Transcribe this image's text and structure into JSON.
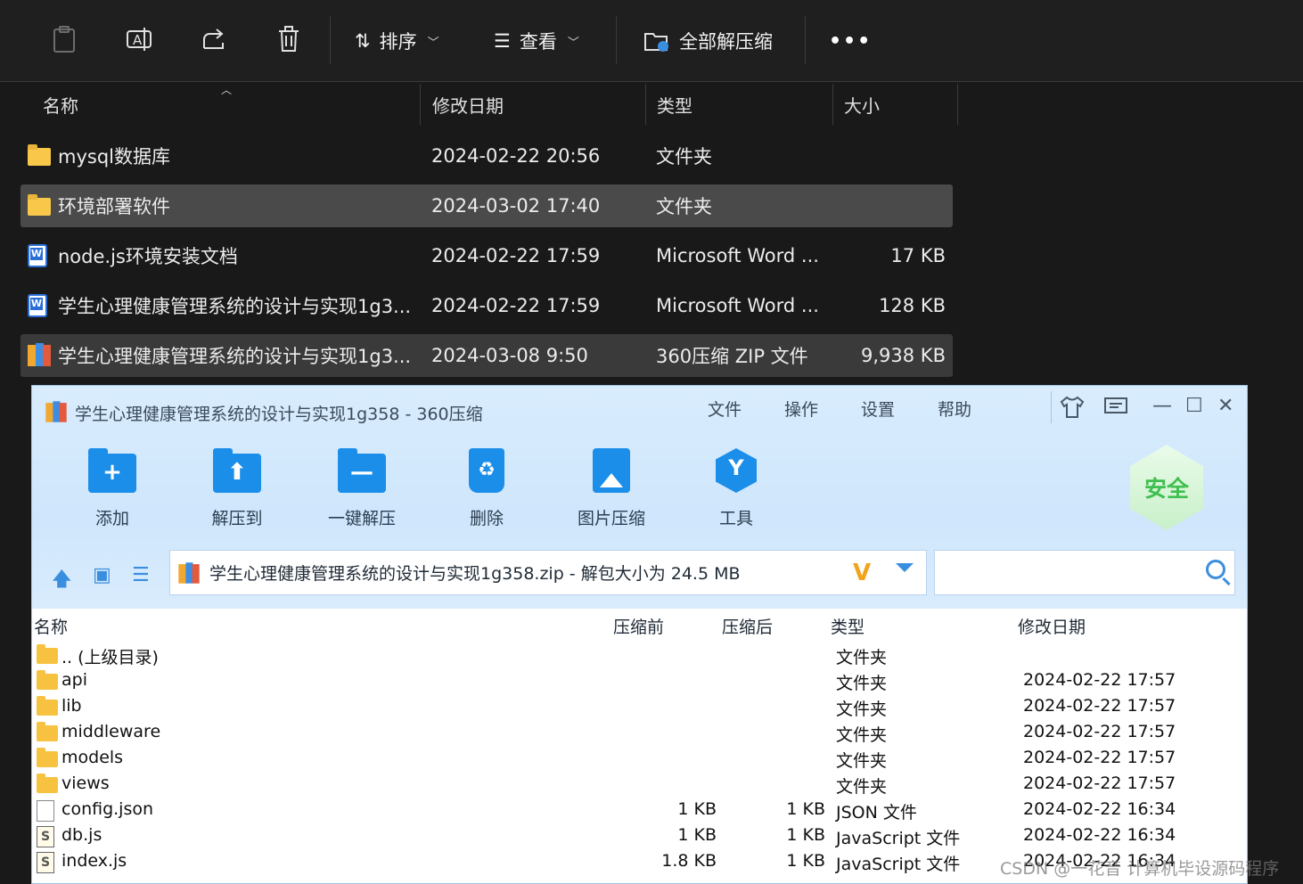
{
  "explorer": {
    "toolbar": {
      "sort_label": "排序",
      "view_label": "查看",
      "extract_all_label": "全部解压缩",
      "more_label": "•••"
    },
    "columns": [
      "名称",
      "修改日期",
      "类型",
      "大小"
    ],
    "rows": [
      {
        "name": "mysql数据库",
        "date": "2024-02-22 20:56",
        "type": "文件夹",
        "size": "",
        "icon": "folder-icon"
      },
      {
        "name": "环境部署软件",
        "date": "2024-03-02 17:40",
        "type": "文件夹",
        "size": "",
        "icon": "folder-icon"
      },
      {
        "name": "node.js环境安装文档",
        "date": "2024-02-22 17:59",
        "type": "Microsoft Word ...",
        "size": "17 KB",
        "icon": "word-icon"
      },
      {
        "name": "学生心理健康管理系统的设计与实现1g3...",
        "date": "2024-02-22 17:59",
        "type": "Microsoft Word ...",
        "size": "128 KB",
        "icon": "word-icon"
      },
      {
        "name": "学生心理健康管理系统的设计与实现1g3...",
        "date": "2024-03-08 9:50",
        "type": "360压缩 ZIP 文件",
        "size": "9,938 KB",
        "icon": "zip-icon"
      }
    ]
  },
  "zipwin": {
    "title": "学生心理健康管理系统的设计与实现1g358 - 360压缩",
    "menu": [
      "文件",
      "操作",
      "设置",
      "帮助"
    ],
    "tools": [
      "添加",
      "解压到",
      "一键解压",
      "删除",
      "图片压缩",
      "工具"
    ],
    "safe_badge": "安全",
    "address": "学生心理健康管理系统的设计与实现1g358.zip - 解包大小为 24.5 MB",
    "search_placeholder": "",
    "columns": [
      "名称",
      "压缩前",
      "压缩后",
      "类型",
      "修改日期"
    ],
    "rows": [
      {
        "name": ".. (上级目录)",
        "pre": "",
        "post": "",
        "type": "文件夹",
        "date": "",
        "icon": "folder-icon"
      },
      {
        "name": "api",
        "pre": "",
        "post": "",
        "type": "文件夹",
        "date": "2024-02-22 17:57",
        "icon": "folder-icon"
      },
      {
        "name": "lib",
        "pre": "",
        "post": "",
        "type": "文件夹",
        "date": "2024-02-22 17:57",
        "icon": "folder-icon"
      },
      {
        "name": "middleware",
        "pre": "",
        "post": "",
        "type": "文件夹",
        "date": "2024-02-22 17:57",
        "icon": "folder-icon"
      },
      {
        "name": "models",
        "pre": "",
        "post": "",
        "type": "文件夹",
        "date": "2024-02-22 17:57",
        "icon": "folder-icon"
      },
      {
        "name": "views",
        "pre": "",
        "post": "",
        "type": "文件夹",
        "date": "2024-02-22 17:57",
        "icon": "folder-icon"
      },
      {
        "name": "config.json",
        "pre": "1 KB",
        "post": "1 KB",
        "type": "JSON 文件",
        "date": "2024-02-22 16:34",
        "icon": "file-icon"
      },
      {
        "name": "db.js",
        "pre": "1 KB",
        "post": "1 KB",
        "type": "JavaScript 文件",
        "date": "2024-02-22 16:34",
        "icon": "js-file-icon"
      },
      {
        "name": "index.js",
        "pre": "1.8 KB",
        "post": "1 KB",
        "type": "JavaScript 文件",
        "date": "2024-02-22 16:34",
        "icon": "js-file-icon"
      }
    ]
  },
  "watermark": "CSDN @一花音 计算机毕设源码程序"
}
